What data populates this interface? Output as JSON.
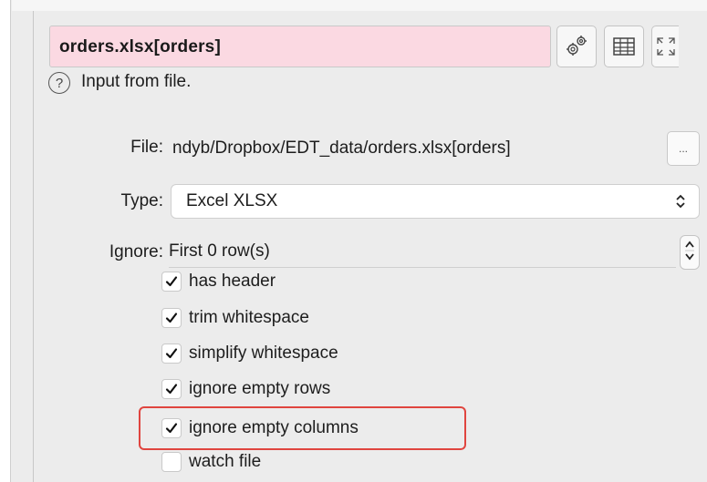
{
  "title": "orders.xlsx[orders]",
  "toolbar": {
    "gear_icon": "settings-gear-icon",
    "table_icon": "table-grid-icon",
    "expand_icon": "expand-arrows-icon"
  },
  "description": "Input from file.",
  "file": {
    "label": "File:",
    "value": "ndyb/Dropbox/EDT_data/orders.xlsx[orders]",
    "browse_label": "..."
  },
  "type": {
    "label": "Type:",
    "value": "Excel XLSX"
  },
  "ignore": {
    "label": "Ignore:",
    "value": "First 0 row(s)"
  },
  "options": [
    {
      "label": "has header",
      "checked": true
    },
    {
      "label": "trim whitespace",
      "checked": true
    },
    {
      "label": "simplify whitespace",
      "checked": true
    },
    {
      "label": "ignore empty rows",
      "checked": true
    },
    {
      "label": "ignore empty columns",
      "checked": true
    },
    {
      "label": "watch file",
      "checked": false
    }
  ],
  "colors": {
    "title_bg": "#fbd9e2",
    "highlight": "#e0453f"
  }
}
